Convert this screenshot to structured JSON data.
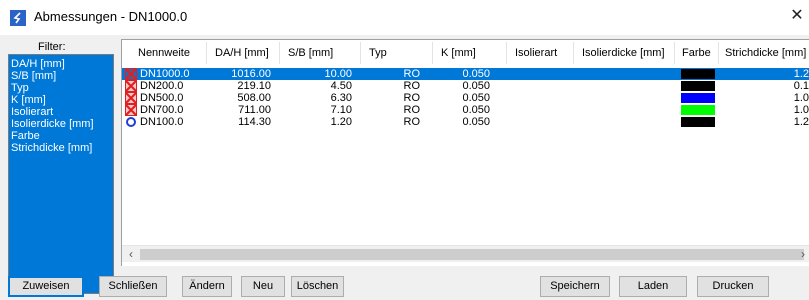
{
  "window": {
    "title": "Abmessungen - DN1000.0",
    "close_symbol": "✕",
    "icon": "app-icon"
  },
  "filter": {
    "label": "Filter:",
    "items": [
      "DA/H [mm]",
      "S/B [mm]",
      "Typ",
      "K [mm]",
      "Isolierart",
      "Isolierdicke [mm]",
      "Farbe",
      "Strichdicke [mm]"
    ]
  },
  "table": {
    "columns": [
      "Nennweite",
      "DA/H [mm]",
      "S/B [mm]",
      "Typ",
      "K [mm]",
      "Isolierart",
      "Isolierdicke [mm]",
      "Farbe",
      "Strichdicke [mm]"
    ],
    "rows": [
      {
        "icon": "red-x-pipe-icon",
        "nennweite": "DN1000.0",
        "da": "1016.00",
        "sb": "10.00",
        "typ": "RO",
        "k": "0.050",
        "isolierart": "",
        "isolierdicke": "",
        "farbe": "#000000",
        "strichdicke": "1.2",
        "selected": true
      },
      {
        "icon": "red-x-pipe-icon",
        "nennweite": "DN200.0",
        "da": "219.10",
        "sb": "4.50",
        "typ": "RO",
        "k": "0.050",
        "isolierart": "",
        "isolierdicke": "",
        "farbe": "#000000",
        "strichdicke": "0.1",
        "selected": false
      },
      {
        "icon": "red-x-pipe-icon",
        "nennweite": "DN500.0",
        "da": "508.00",
        "sb": "6.30",
        "typ": "RO",
        "k": "0.050",
        "isolierart": "",
        "isolierdicke": "",
        "farbe": "#0000ff",
        "strichdicke": "1.0",
        "selected": false
      },
      {
        "icon": "red-x-pipe-icon",
        "nennweite": "DN700.0",
        "da": "711.00",
        "sb": "7.10",
        "typ": "RO",
        "k": "0.050",
        "isolierart": "",
        "isolierdicke": "",
        "farbe": "#00ff00",
        "strichdicke": "1.0",
        "selected": false
      },
      {
        "icon": "blue-circle-icon",
        "nennweite": "DN100.0",
        "da": "114.30",
        "sb": "1.20",
        "typ": "RO",
        "k": "0.050",
        "isolierart": "",
        "isolierdicke": "",
        "farbe": "#000000",
        "strichdicke": "1.2",
        "selected": false
      }
    ],
    "scroll_left": "‹",
    "scroll_right": "›"
  },
  "buttons": {
    "zuweisen": "Zuweisen",
    "schliessen": "Schließen",
    "aendern": "Ändern",
    "neu": "Neu",
    "loeschen": "Löschen",
    "speichern": "Speichern",
    "laden": "Laden",
    "drucken": "Drucken"
  },
  "colors": {
    "selection": "#0078d7",
    "icon_red": "#e02020",
    "icon_blue": "#1f3fd1"
  }
}
